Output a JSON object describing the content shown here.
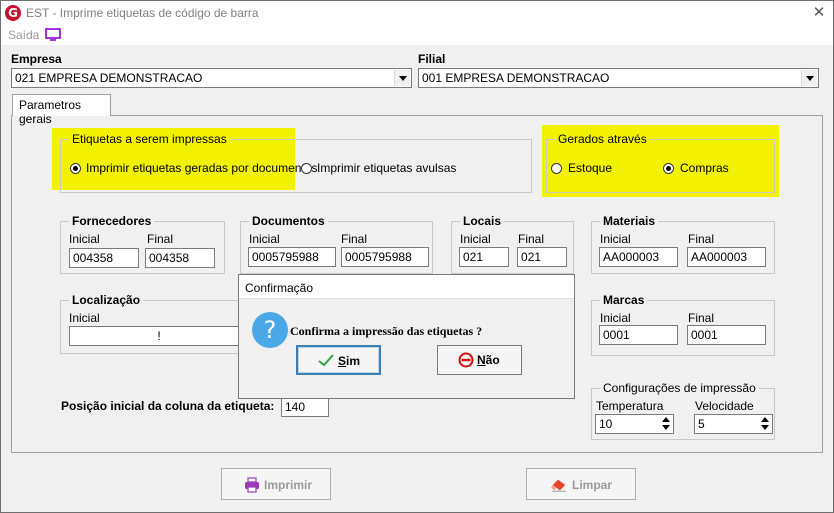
{
  "window": {
    "title": "EST - Imprime etiquetas de código de barra",
    "close_glyph": "✕"
  },
  "menu": {
    "saida": "Saída"
  },
  "empresa": {
    "label": "Empresa",
    "value": "021 EMPRESA DEMONSTRACAO"
  },
  "filial": {
    "label": "Filial",
    "value": "001 EMPRESA DEMONSTRACAO"
  },
  "tabs": [
    {
      "label": "Parametros gerais"
    }
  ],
  "etiquetas": {
    "title": "Etiquetas a serem impressas",
    "option_documentos": "Imprimir etiquetas geradas por documentos",
    "option_avulsas": "Imprimir etiquetas avulsas",
    "selected": "documentos"
  },
  "gerados": {
    "title": "Gerados através",
    "option_estoque": "Estoque",
    "option_compras": "Compras",
    "selected": "compras"
  },
  "fornecedores": {
    "title": "Fornecedores",
    "inicial_label": "Inicial",
    "final_label": "Final",
    "inicial": "004358",
    "final": "004358"
  },
  "documentos": {
    "title": "Documentos",
    "inicial_label": "Inicial",
    "final_label": "Final",
    "inicial": "0005795988",
    "final": "0005795988"
  },
  "locais": {
    "title": "Locais",
    "inicial_label": "Inicial",
    "final_label": "Final",
    "inicial": "021",
    "final": "021"
  },
  "materiais": {
    "title": "Materiais",
    "inicial_label": "Inicial",
    "final_label": "Final",
    "inicial": "AA000003",
    "final": "AA000003"
  },
  "localizacao": {
    "title": "Localização",
    "inicial_label": "Inicial",
    "inicial": "!"
  },
  "marcas": {
    "title": "Marcas",
    "inicial_label": "Inicial",
    "final_label": "Final",
    "inicial": "0001",
    "final": "0001"
  },
  "posicao": {
    "label": "Posição inicial da coluna da etiqueta:",
    "value": "140"
  },
  "config": {
    "title": "Configurações de impressão",
    "temperatura_label": "Temperatura",
    "temperatura": "10",
    "velocidade_label": "Velocidade",
    "velocidade": "5"
  },
  "buttons": {
    "imprimir": "Imprimir",
    "limpar": "Limpar"
  },
  "dialog": {
    "title": "Confirmação",
    "message": "Confirma a impressão das etiquetas ?",
    "icon_glyph": "?",
    "sim_first": "S",
    "sim_rest": "im",
    "nao_first": "N",
    "nao_rest": "ão"
  },
  "colors": {
    "highlight": "#f2f200",
    "dialog_icon": "#4aa8e8",
    "logo": "#c8102e",
    "monitor_icon": "#8b00d8",
    "check_icon": "#2ea43a",
    "stop_icon": "#d01010",
    "eraser_icon": "#e8432e",
    "printer_icon": "#9b3bb8"
  }
}
